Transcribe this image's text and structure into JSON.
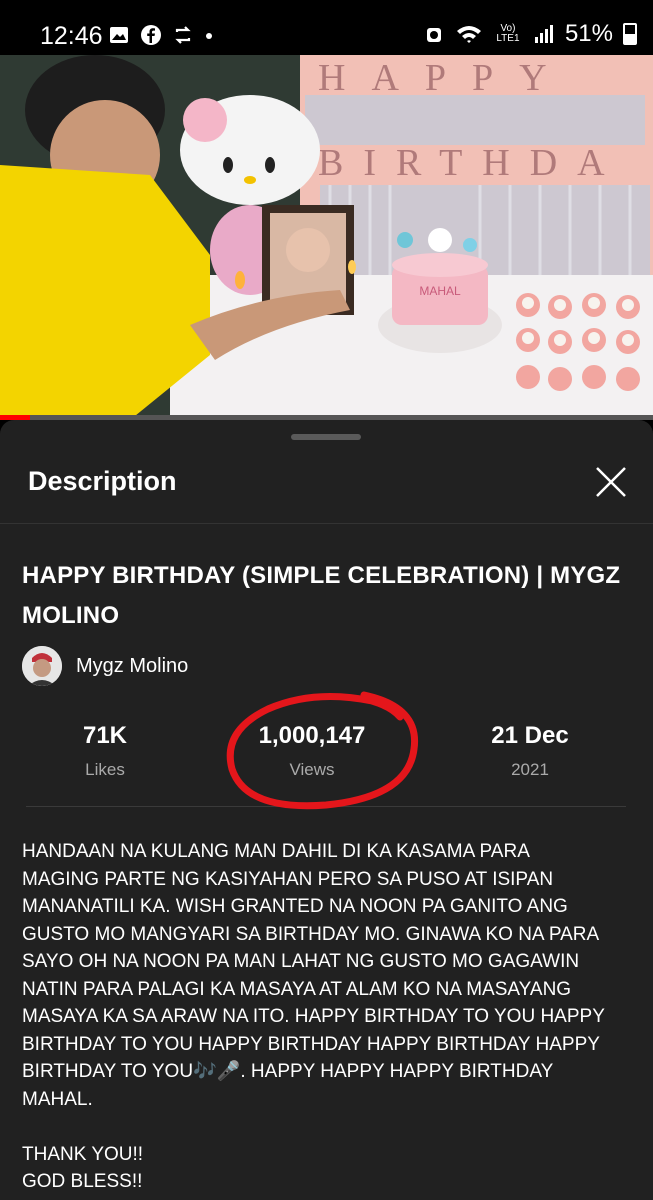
{
  "status_bar": {
    "time": "12:46",
    "battery": "51%",
    "network": "Vo) LTE1"
  },
  "video": {
    "banner_line1": "HAPPY",
    "banner_line2": "BIRTHDA",
    "cake_text": "MAHAL"
  },
  "sheet": {
    "title": "Description",
    "video_title": "HAPPY BIRTHDAY (SIMPLE CELEBRATION) | MYGZ MOLINO",
    "channel_name": "Mygz Molino",
    "stats": {
      "likes_value": "71K",
      "likes_label": "Likes",
      "views_value": "1,000,147",
      "views_label": "Views",
      "date_value": "21 Dec",
      "date_year": "2021"
    },
    "description": "HANDAAN NA KULANG MAN DAHIL DI KA KASAMA PARA\nMAGING PARTE NG KASIYAHAN PERO SA PUSO AT ISIPAN\nMANANATILI KA. WISH GRANTED NA NOON PA GANITO ANG\nGUSTO MO MANGYARI SA BIRTHDAY MO. GINAWA KO NA PARA\nSAYO OH NA NOON PA MAN LAHAT NG GUSTO MO GAGAWIN\nNATIN PARA PALAGI KA MASAYA AT ALAM KO NA MASAYANG\nMASAYA KA SA ARAW NA ITO. HAPPY BIRTHDAY TO YOU HAPPY\nBIRTHDAY TO YOU HAPPY BIRTHDAY HAPPY BIRTHDAY HAPPY\nBIRTHDAY TO YOU🎶🎤. HAPPY HAPPY HAPPY BIRTHDAY\nMAHAL.\n\nTHANK YOU!!\nGOD BLESS!!"
  },
  "colors": {
    "sheet_bg": "#212121",
    "annotation_circle": "#e4161b",
    "progress": "#ff0000"
  }
}
